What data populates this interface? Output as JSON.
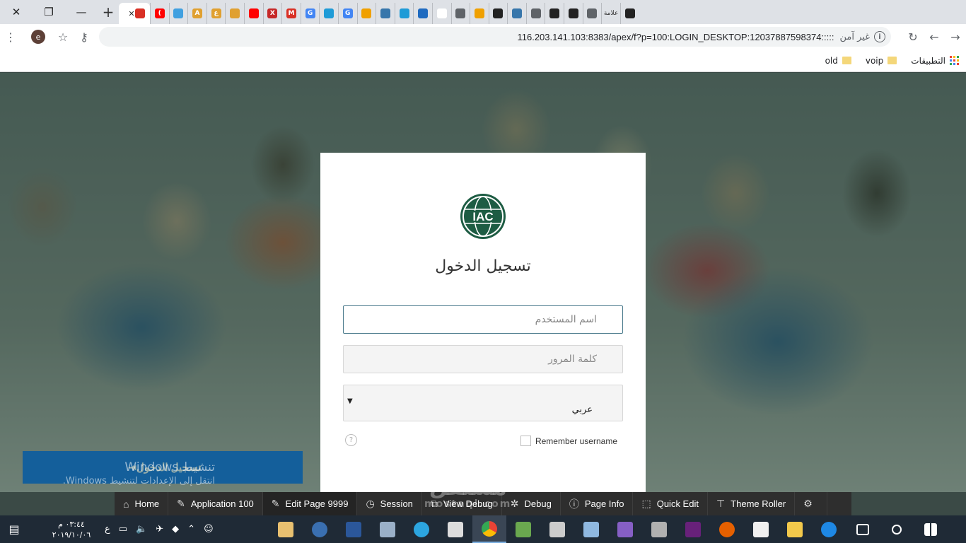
{
  "browser": {
    "tabs": [
      {
        "letter": "",
        "color": "#d93025"
      },
      {
        "letter": "(",
        "color": "#ff0000"
      },
      {
        "letter": "",
        "color": "#40a0e0"
      },
      {
        "letter": "A",
        "color": "#e0a030"
      },
      {
        "letter": "ع",
        "color": "#e0a030"
      },
      {
        "letter": "",
        "color": "#e0a030"
      },
      {
        "letter": "",
        "color": "#ff0000"
      },
      {
        "letter": "X",
        "color": "#c62828"
      },
      {
        "letter": "M",
        "color": "#d93025"
      },
      {
        "letter": "G",
        "color": "#4285f4"
      },
      {
        "letter": "",
        "color": "#1e9bd7"
      },
      {
        "letter": "G",
        "color": "#4285f4"
      },
      {
        "letter": "",
        "color": "#f0a000"
      },
      {
        "letter": "",
        "color": "#3776ab"
      },
      {
        "letter": "",
        "color": "#1e9bd7"
      },
      {
        "letter": "",
        "color": "#1e6ac0"
      },
      {
        "letter": "",
        "color": "#ffffff"
      },
      {
        "letter": "",
        "color": "#5f6368"
      },
      {
        "letter": "",
        "color": "#f0a000"
      },
      {
        "letter": "",
        "color": "#222222"
      },
      {
        "letter": "",
        "color": "#3776ab"
      },
      {
        "letter": "",
        "color": "#5f6368"
      },
      {
        "letter": "",
        "color": "#222222"
      },
      {
        "letter": "",
        "color": "#222222"
      },
      {
        "letter": "",
        "color": "#5f6368"
      },
      {
        "letter": "علامة",
        "color": "#5f6368"
      },
      {
        "letter": "",
        "color": "#222222"
      }
    ],
    "new_tab": "+",
    "minimize": "—",
    "restore": "❐",
    "close": "✕",
    "url": "116.203.141.103:8383/apex/f?p=100:LOGIN_DESKTOP:12037887598374:::::",
    "not_secure": "غير آمن",
    "profile_letter": "e",
    "bookmarks": [
      "التطبيقات",
      "voip",
      "old"
    ]
  },
  "login": {
    "logo_text": "IAC",
    "title": "تسجيل الدخول",
    "username_placeholder": "اسم المستخدم",
    "password_placeholder": "كلمة المرور",
    "language_value": "عربي",
    "remember_label": "Remember username",
    "help": "?",
    "button_label": "تسجيل الدخول"
  },
  "activation": {
    "line1": "تنشيط Windows",
    "line2": "انتقل إلى الإعدادات لتنشيط Windows."
  },
  "devbar": {
    "items": [
      "Home",
      "Application 100",
      "Edit Page 9999",
      "Session",
      "View Debug",
      "Debug",
      "Page Info",
      "Quick Edit",
      "Theme Roller"
    ]
  },
  "watermark": {
    "main": "مستقل",
    "sub": "mostaql.com"
  },
  "taskbar": {
    "time": "٠٣:٤٤ م",
    "date": "٢٠١٩/١٠/٠٦",
    "lang": "ع"
  },
  "colors": {
    "accent": "#1473e6",
    "logo": "#1d5c43",
    "overlay": "#14463f"
  }
}
